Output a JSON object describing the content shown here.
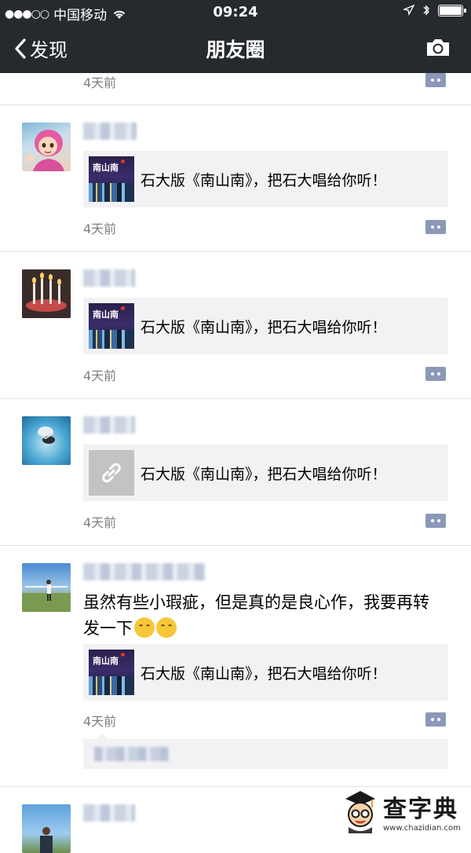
{
  "status_bar": {
    "carrier": "中国移动",
    "time": "09:24"
  },
  "nav": {
    "back_label": "发现",
    "title": "朋友圈"
  },
  "top_fragment": {
    "time": "4天前"
  },
  "posts": [
    {
      "share": {
        "title": "石大版《南山南》，把石大唱给你听！",
        "thumb": "nanshan-cover"
      },
      "time": "4天前"
    },
    {
      "share": {
        "title": "石大版《南山南》，把石大唱给你听！",
        "thumb": "nanshan-cover"
      },
      "time": "4天前"
    },
    {
      "share": {
        "title": "石大版《南山南》，把石大唱给你听！",
        "thumb": "link-icon"
      },
      "time": "4天前"
    },
    {
      "text": "虽然有些小瑕疵，但是真的是良心作，我要再转发一下",
      "share": {
        "title": "石大版《南山南》，把石大唱给你听！",
        "thumb": "nanshan-cover"
      },
      "time": "4天前"
    }
  ],
  "thumb_label": "南山南",
  "watermark": {
    "main": "查字典",
    "sub": "www.chazidian.com"
  },
  "colors": {
    "nav_bg": "#262a2e",
    "card_bg": "#f2f2f5",
    "time_text": "#7f7f7f",
    "comment_icon": "#8b98b8"
  }
}
